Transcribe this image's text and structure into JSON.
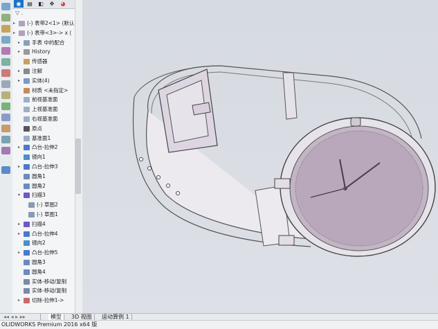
{
  "tree": {
    "filter_icon": "filter-icon",
    "tabs": [
      "feature-manager-icon",
      "property-manager-icon",
      "configuration-manager-icon",
      "dimxpert-icon",
      "display-manager-icon"
    ],
    "items": [
      {
        "label": "(-) 表带2<1> (默认",
        "indent": 1,
        "arrow": "▸",
        "icon": "part-icon"
      },
      {
        "label": "(-) 表带<3>-> x (",
        "indent": 1,
        "arrow": "▸",
        "icon": "part-icon"
      },
      {
        "label": "手表 中的配合",
        "indent": 2,
        "arrow": "▸",
        "icon": "mates-icon"
      },
      {
        "label": "History",
        "indent": 2,
        "arrow": "▸",
        "icon": "history-icon"
      },
      {
        "label": "传感器",
        "indent": 2,
        "arrow": "",
        "icon": "sensor-icon"
      },
      {
        "label": "注解",
        "indent": 2,
        "arrow": "▸",
        "icon": "annotation-icon"
      },
      {
        "label": "实体(4)",
        "indent": 2,
        "arrow": "▸",
        "icon": "solid-bodies-icon"
      },
      {
        "label": "材质 <未指定>",
        "indent": 2,
        "arrow": "",
        "icon": "material-icon"
      },
      {
        "label": "前视基准面",
        "indent": 2,
        "arrow": "",
        "icon": "plane-icon"
      },
      {
        "label": "上视基准面",
        "indent": 2,
        "arrow": "",
        "icon": "plane-icon"
      },
      {
        "label": "右视基准面",
        "indent": 2,
        "arrow": "",
        "icon": "plane-icon"
      },
      {
        "label": "原点",
        "indent": 2,
        "arrow": "",
        "icon": "origin-icon"
      },
      {
        "label": "基准面1",
        "indent": 2,
        "arrow": "",
        "icon": "plane-icon"
      },
      {
        "label": "凸台-拉伸2",
        "indent": 2,
        "arrow": "▸",
        "icon": "extrude-icon"
      },
      {
        "label": "镜向1",
        "indent": 2,
        "arrow": "",
        "icon": "mirror-icon"
      },
      {
        "label": "凸台-拉伸3",
        "indent": 2,
        "arrow": "▸",
        "icon": "extrude-icon"
      },
      {
        "label": "圆角1",
        "indent": 2,
        "arrow": "",
        "icon": "fillet-icon"
      },
      {
        "label": "圆角2",
        "indent": 2,
        "arrow": "",
        "icon": "fillet-icon"
      },
      {
        "label": "扫描3",
        "indent": 2,
        "arrow": "▾",
        "icon": "sweep-icon"
      },
      {
        "label": "(-) 草图2",
        "indent": 3,
        "arrow": "",
        "icon": "sketch-icon"
      },
      {
        "label": "(-) 草图1",
        "indent": 3,
        "arrow": "",
        "icon": "sketch-icon"
      },
      {
        "label": "扫描4",
        "indent": 2,
        "arrow": "▸",
        "icon": "sweep-icon"
      },
      {
        "label": "凸台-拉伸4",
        "indent": 2,
        "arrow": "▸",
        "icon": "extrude-icon"
      },
      {
        "label": "镜向2",
        "indent": 2,
        "arrow": "",
        "icon": "mirror-icon"
      },
      {
        "label": "凸台-拉伸5",
        "indent": 2,
        "arrow": "▸",
        "icon": "extrude-icon"
      },
      {
        "label": "圆角3",
        "indent": 2,
        "arrow": "",
        "icon": "fillet-icon"
      },
      {
        "label": "圆角4",
        "indent": 2,
        "arrow": "",
        "icon": "fillet-icon"
      },
      {
        "label": "实体-移动/复制",
        "indent": 2,
        "arrow": "",
        "icon": "move-body-icon"
      },
      {
        "label": "实体-移动/复制",
        "indent": 2,
        "arrow": "",
        "icon": "move-body-icon"
      },
      {
        "label": "切除-拉伸1->",
        "indent": 2,
        "arrow": "▸",
        "icon": "cut-extrude-icon"
      }
    ]
  },
  "bottom_tabs": [
    "模型",
    "3D 视图",
    "运动算例 1"
  ],
  "status": "OLIDWORKS Premium 2016 x64 版",
  "colors": {
    "accent": "#1a73c9",
    "watch_face": "#b9a8bb",
    "band": "#e8e4ec"
  }
}
